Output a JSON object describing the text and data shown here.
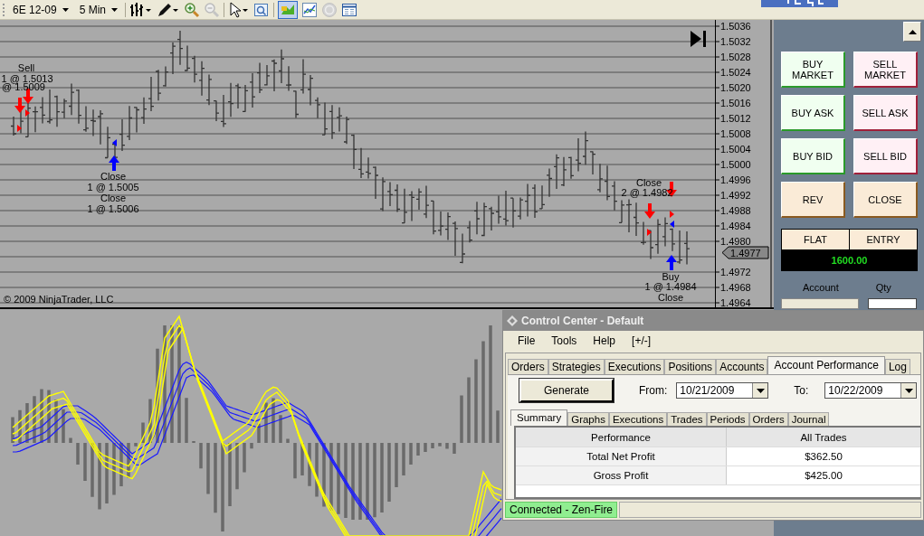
{
  "toolbar": {
    "instrument": "6E 12-09",
    "interval": "5 Min"
  },
  "price_chart": {
    "axis_labels": [
      "1.5036",
      "1.5032",
      "1.5028",
      "1.5024",
      "1.5020",
      "1.5016",
      "1.5012",
      "1.5008",
      "1.5004",
      "1.5000",
      "1.4996",
      "1.4992",
      "1.4988",
      "1.4984",
      "1.4980",
      "1.4972",
      "1.4968",
      "1.4964"
    ],
    "last_price": "1.4977",
    "annotations": [
      {
        "text": "Sell"
      },
      {
        "text": "1 @ 1.5013"
      },
      {
        "text": "@ 1.5009"
      },
      {
        "text": "Close"
      },
      {
        "text": "1 @ 1.5005"
      },
      {
        "text": "Close"
      },
      {
        "text": "1 @ 1.5006"
      },
      {
        "text": "Close"
      },
      {
        "text": "2 @ 1.4982"
      },
      {
        "text": "Buy"
      },
      {
        "text": "1 @ 1.4984"
      },
      {
        "text": "Close"
      }
    ],
    "copyright": "© 2009 NinjaTrader, LLC"
  },
  "order_panel": {
    "buttons": [
      {
        "label": "BUY MARKET",
        "kind": "buy"
      },
      {
        "label": "SELL MARKET",
        "kind": "sell"
      },
      {
        "label": "BUY ASK",
        "kind": "buy"
      },
      {
        "label": "SELL ASK",
        "kind": "sell"
      },
      {
        "label": "BUY BID",
        "kind": "buy"
      },
      {
        "label": "SELL BID",
        "kind": "sell"
      },
      {
        "label": "REV",
        "kind": "neutral"
      },
      {
        "label": "CLOSE",
        "kind": "neutral"
      }
    ],
    "position": {
      "status": "FLAT",
      "label": "ENTRY",
      "value": "1600.00"
    },
    "account_label": "Account",
    "qty_label": "Qty"
  },
  "control_center": {
    "title": "Control Center - Default",
    "menu": [
      "File",
      "Tools",
      "Help",
      "[+/-]"
    ],
    "tabs": [
      {
        "label": "Orders",
        "selected": false
      },
      {
        "label": "Strategies",
        "selected": false
      },
      {
        "label": "Executions",
        "selected": false
      },
      {
        "label": "Positions",
        "selected": false
      },
      {
        "label": "Accounts",
        "selected": false
      },
      {
        "label": "Account Performance",
        "selected": true
      },
      {
        "label": "Log",
        "selected": false
      }
    ],
    "generate": "Generate",
    "from_label": "From:",
    "from": "10/21/2009",
    "to_label": "To:",
    "to": "10/22/2009",
    "subtabs": [
      {
        "label": "Summary",
        "selected": true
      },
      {
        "label": "Graphs",
        "selected": false
      },
      {
        "label": "Executions",
        "selected": false
      },
      {
        "label": "Trades",
        "selected": false
      },
      {
        "label": "Periods",
        "selected": false
      },
      {
        "label": "Orders",
        "selected": false
      },
      {
        "label": "Journal",
        "selected": false
      }
    ],
    "table": {
      "columns": [
        "Performance",
        "All Trades"
      ],
      "rows": [
        [
          "Total Net Profit",
          "$362.50"
        ],
        [
          "Gross Profit",
          "$425.00"
        ]
      ]
    },
    "status": "Connected - Zen-Fire"
  }
}
